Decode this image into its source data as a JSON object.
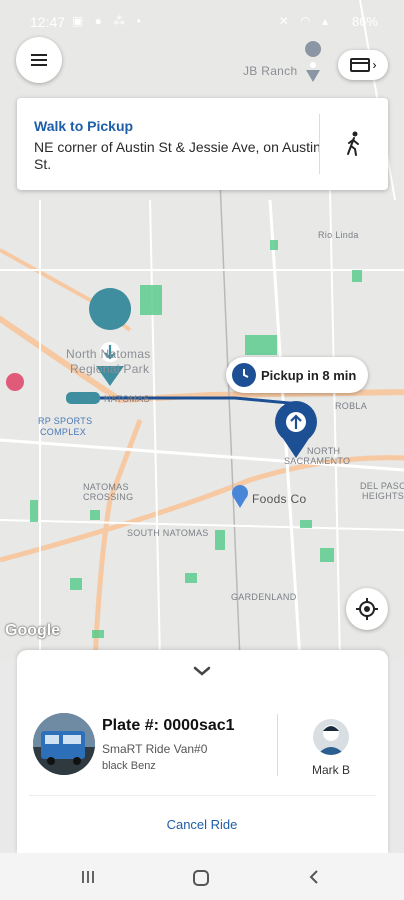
{
  "status_bar": {
    "time": "12:47",
    "battery": "86%"
  },
  "map": {
    "labels": {
      "jb_ranch": "JB Ranch",
      "rio_linda": "Rio Linda",
      "north_natomas_park_1": "North Natomas",
      "north_natomas_park_2": "Regional Park",
      "natomas": "NATOMAS",
      "rp_sports_1": "RP SPORTS",
      "rp_sports_2": "COMPLEX",
      "robla": "ROBLA",
      "north_sacramento_1": "NORTH",
      "north_sacramento_2": "SACRAMENTO",
      "natomas_crossing_1": "NATOMAS",
      "natomas_crossing_2": "CROSSING",
      "foods_co": "Foods Co",
      "del_paso_1": "DEL PASO",
      "del_paso_2": "HEIGHTS",
      "south_natomas": "SOUTH NATOMAS",
      "gardenland": "GARDENLAND"
    },
    "google_logo": "Google",
    "eta_text": "Pickup in 8 min"
  },
  "walk_card": {
    "title": "Walk to Pickup",
    "address": "NE corner of Austin St & Jessie Ave, on Austin St."
  },
  "ride": {
    "plate": "Plate #: 0000sac1",
    "vehicle_name": "SmaRT Ride Van#0",
    "vehicle_desc": "black Benz",
    "driver_name": "Mark B",
    "cancel_label": "Cancel Ride"
  },
  "colors": {
    "brand_blue": "#1e5ea8",
    "route_blue": "#1d4f94",
    "pin_teal": "#3f8ea0",
    "park_green": "#52c98a"
  },
  "icons": {
    "menu": "hamburger-icon",
    "payment": "credit-card-icon",
    "walk": "walking-person-icon",
    "clock": "clock-icon",
    "locate": "my-location-icon",
    "chevron": "chevron-down-icon"
  }
}
